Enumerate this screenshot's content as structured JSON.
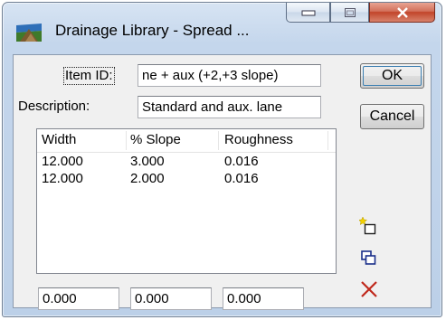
{
  "window": {
    "title": "Drainage Library - Spread ...",
    "icon": "library-icon"
  },
  "caption": {
    "minimize_icon": "minimize-icon",
    "maximize_icon": "maximize-icon",
    "close_icon": "close-icon"
  },
  "form": {
    "item_id_label": "Item ID:",
    "item_id_value": "ne + aux (+2,+3 slope)",
    "description_label": "Description:",
    "description_value": "Standard and aux. lane"
  },
  "buttons": {
    "ok": "OK",
    "cancel": "Cancel"
  },
  "table": {
    "columns": [
      "Width",
      "% Slope",
      "Roughness"
    ],
    "rows": [
      [
        "12.000",
        "3.000",
        "0.016"
      ],
      [
        "12.000",
        "2.000",
        "0.016"
      ]
    ]
  },
  "edit_fields": [
    "0.000",
    "0.000",
    "0.000"
  ],
  "tools": {
    "add_icon": "add-row-icon",
    "copy_icon": "copy-row-icon",
    "delete_icon": "delete-row-icon"
  },
  "colors": {
    "close_button": "#c2442a",
    "delete_icon": "#c0281c",
    "copy_icon": "#1a2f8a",
    "add_star": "#f2d100"
  }
}
